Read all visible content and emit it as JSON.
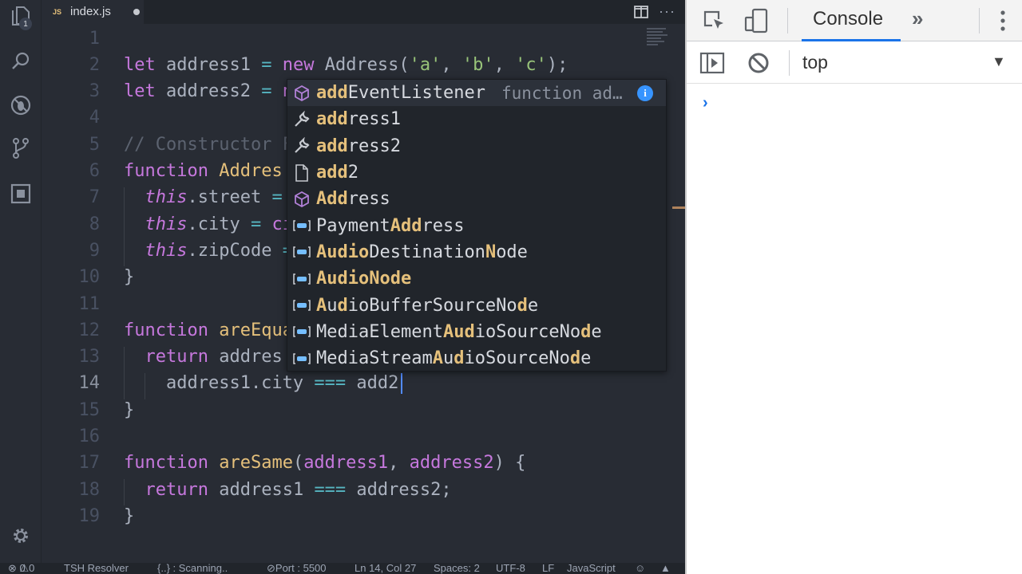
{
  "activity_bar": {
    "explorer_badge": "1",
    "icons": [
      "files-icon",
      "search-icon",
      "debug-icon",
      "source-control-icon",
      "extensions-icon",
      "settings-gear-icon"
    ]
  },
  "tab": {
    "lang_badge": "JS",
    "file_name": "index.js"
  },
  "code": {
    "line_numbers": [
      "1",
      "2",
      "3",
      "4",
      "5",
      "6",
      "7",
      "8",
      "9",
      "10",
      "11",
      "12",
      "13",
      "14",
      "15",
      "16",
      "17",
      "18",
      "19"
    ],
    "current_line": "14"
  },
  "suggestions": [
    {
      "icon": "method-cube-icon",
      "pre": "",
      "bold": "add",
      "post": "EventListener",
      "detail": "function ad…",
      "selected": true
    },
    {
      "icon": "wrench-icon",
      "pre": "",
      "bold": "add",
      "post": "ress1"
    },
    {
      "icon": "wrench-icon",
      "pre": "",
      "bold": "add",
      "post": "ress2"
    },
    {
      "icon": "file-icon",
      "pre": "",
      "bold": "add",
      "post": "2"
    },
    {
      "icon": "class-cube-icon",
      "pre": "",
      "bold": "Add",
      "post": "ress"
    },
    {
      "icon": "interface-icon",
      "pre": "Payment",
      "bold": "Add",
      "post": "ress"
    }
  ],
  "suggestion_info_glyph": "i",
  "status_bar": {
    "errors": "0",
    "warnings": "0",
    "resolver": "TSH Resolver",
    "scanning": "{..} : Scanning..",
    "port": "Port : 5500",
    "position": "Ln 14, Col 27",
    "spaces": "Spaces: 2",
    "encoding": "UTF-8",
    "eol": "LF",
    "language": "JavaScript"
  },
  "devtools": {
    "active_tab": "Console",
    "more_tabs": "»",
    "context": "top",
    "prompt": "›"
  },
  "colors": {
    "editor_bg": "#282c34",
    "keyword": "#c678dd",
    "function": "#e5c07b",
    "string": "#98c379",
    "accent": "#1a73e8"
  }
}
